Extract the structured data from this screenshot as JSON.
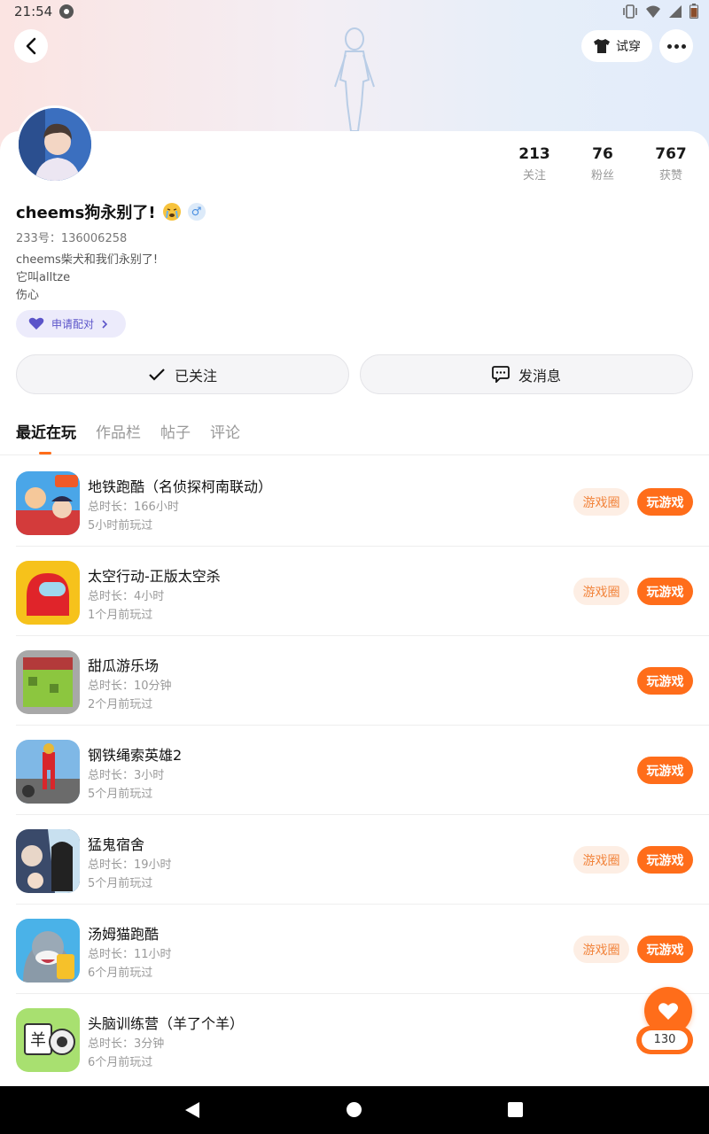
{
  "status_bar": {
    "time": "21:54"
  },
  "header": {
    "tryon_label": "试穿"
  },
  "profile": {
    "stats": [
      {
        "value": "213",
        "label": "关注"
      },
      {
        "value": "76",
        "label": "粉丝"
      },
      {
        "value": "767",
        "label": "获赞"
      }
    ],
    "nickname": "cheems狗永别了!",
    "gender_symbol": "♂",
    "uid": "233号：136006258",
    "bio_lines": [
      "cheems柴犬和我们永别了!",
      "它叫alltze",
      "伤心"
    ],
    "pair_label": "申请配对"
  },
  "actions": {
    "followed_label": "已关注",
    "message_label": "发消息"
  },
  "tabs": [
    "最近在玩",
    "作品栏",
    "帖子",
    "评论"
  ],
  "games": [
    {
      "title": "地铁跑酷（名侦探柯南联动）",
      "duration": "总时长：166小时",
      "last_played": "5小时前玩过",
      "circle": "游戏圈",
      "play": "玩游戏"
    },
    {
      "title": "太空行动-正版太空杀",
      "duration": "总时长：4小时",
      "last_played": "1个月前玩过",
      "circle": "游戏圈",
      "play": "玩游戏"
    },
    {
      "title": "甜瓜游乐场",
      "duration": "总时长：10分钟",
      "last_played": "2个月前玩过",
      "play": "玩游戏"
    },
    {
      "title": "钢铁绳索英雄2",
      "duration": "总时长：3小时",
      "last_played": "5个月前玩过",
      "play": "玩游戏"
    },
    {
      "title": "猛鬼宿舍",
      "duration": "总时长：19小时",
      "last_played": "5个月前玩过",
      "circle": "游戏圈",
      "play": "玩游戏"
    },
    {
      "title": "汤姆猫跑酷",
      "duration": "总时长：11小时",
      "last_played": "6个月前玩过",
      "circle": "游戏圈",
      "play": "玩游戏"
    },
    {
      "title": "头脑训练营（羊了个羊）",
      "duration": "总时长：3分钟",
      "last_played": "6个月前玩过"
    }
  ],
  "like_fab": {
    "count": "130"
  },
  "colors": {
    "accent": "#ff6d1a",
    "circle_bg": "#fdeee4",
    "circle_text": "#f2843c",
    "pair_text": "#5b54c9"
  }
}
